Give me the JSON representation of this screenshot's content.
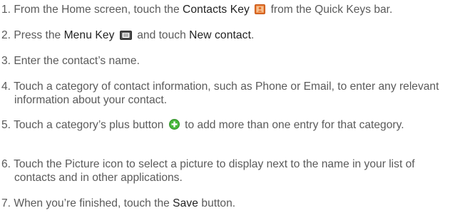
{
  "steps": [
    {
      "number": "1.",
      "parts": {
        "a": "From the Home screen, touch the ",
        "b": "Contacts Key",
        "c": " from the Quick Keys bar."
      }
    },
    {
      "number": "2.",
      "parts": {
        "a": "Press the ",
        "b": "Menu Key",
        "c": " and touch ",
        "d": "New contact",
        "e": "."
      }
    },
    {
      "number": "3.",
      "parts": {
        "a": "Enter the contact’s name."
      }
    },
    {
      "number": "4.",
      "parts": {
        "a": "Touch a category of contact information, such as Phone or Email, to enter any relevant information about your contact."
      }
    },
    {
      "number": "5.",
      "parts": {
        "a": "Touch a category’s plus button ",
        "c": " to add more than one entry for that category."
      }
    },
    {
      "number": "6.",
      "parts": {
        "a": "Touch the Picture icon to select a picture to display next to the name in your list of contacts and in other applications."
      }
    },
    {
      "number": "7.",
      "parts": {
        "a": "When you’re finished, touch the ",
        "b": "Save",
        "c": " button."
      }
    }
  ],
  "icons": {
    "contacts_key": "contacts-key-icon",
    "menu_key": "menu-key-icon",
    "plus_button": "plus-button-icon"
  },
  "colors": {
    "body_text": "#5a5a5a",
    "emphasis_text": "#222222",
    "contacts_icon": "#e3702a",
    "plus_icon": "#49b83c"
  }
}
